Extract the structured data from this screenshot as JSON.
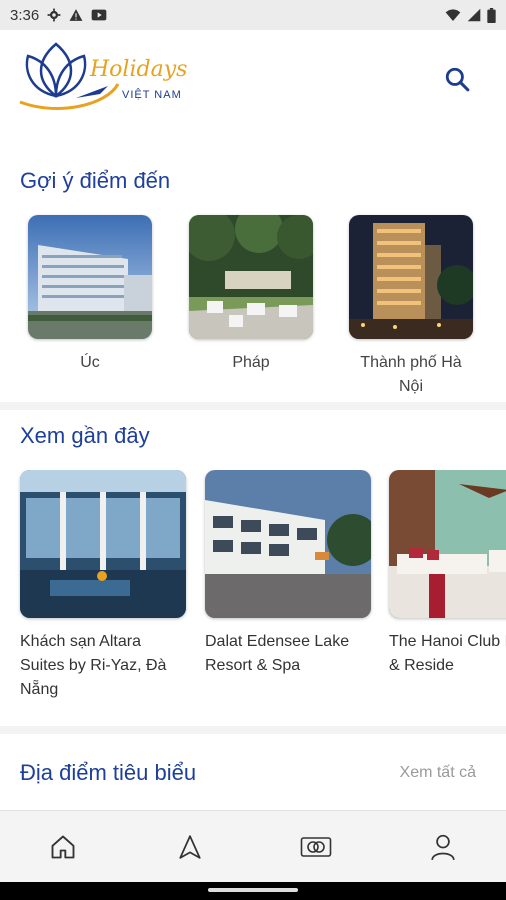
{
  "status_bar": {
    "time": "3:36"
  },
  "header": {
    "logo_script": "Holidays",
    "logo_sub": "VIỆT NAM"
  },
  "sections": {
    "suggested_title": "Gợi ý điểm đến",
    "recent_title": "Xem gần đây",
    "featured_title": "Địa điểm tiêu biểu",
    "see_all_label": "Xem tất cả"
  },
  "destinations": [
    {
      "label": "Úc"
    },
    {
      "label": "Pháp"
    },
    {
      "label": "Thành phố Hà Nội"
    }
  ],
  "recent": [
    {
      "label": "Khách sạn Altara Suites by Ri-Yaz, Đà Nẵng"
    },
    {
      "label": "Dalat Edensee Lake Resort & Spa"
    },
    {
      "label": "The Hanoi Club Hotel & Reside"
    }
  ],
  "colors": {
    "accent": "#1e3f9a",
    "logo_gold": "#e8a21f",
    "logo_blue": "#1d3c8f"
  }
}
